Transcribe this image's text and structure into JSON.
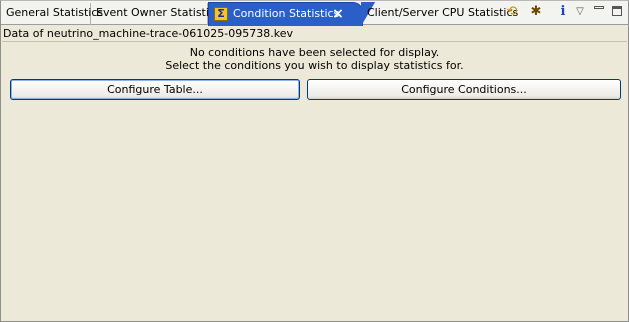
{
  "tabs": [
    {
      "label": "General Statistics"
    },
    {
      "label": "Event Owner Statistics"
    },
    {
      "label": "Condition Statistics",
      "active": true,
      "icon": "sigma-icon"
    },
    {
      "label": "Client/Server CPU Statistics"
    }
  ],
  "toolbar": {
    "sync_icon": "⟲",
    "debug_icon": "✱",
    "info_icon": "i",
    "menu_icon": "▽"
  },
  "data_line": "Data of neutrino_machine-trace-061025-095738.kev",
  "message": {
    "line1": "No conditions have been selected for display.",
    "line2": "Select the conditions you wish to display statistics for."
  },
  "buttons": {
    "configure_table": "Configure Table...",
    "configure_conditions": "Configure Conditions..."
  },
  "colors": {
    "active_tab": "#2a5fc7",
    "background": "#ece9d8",
    "button_border": "#003c74"
  }
}
